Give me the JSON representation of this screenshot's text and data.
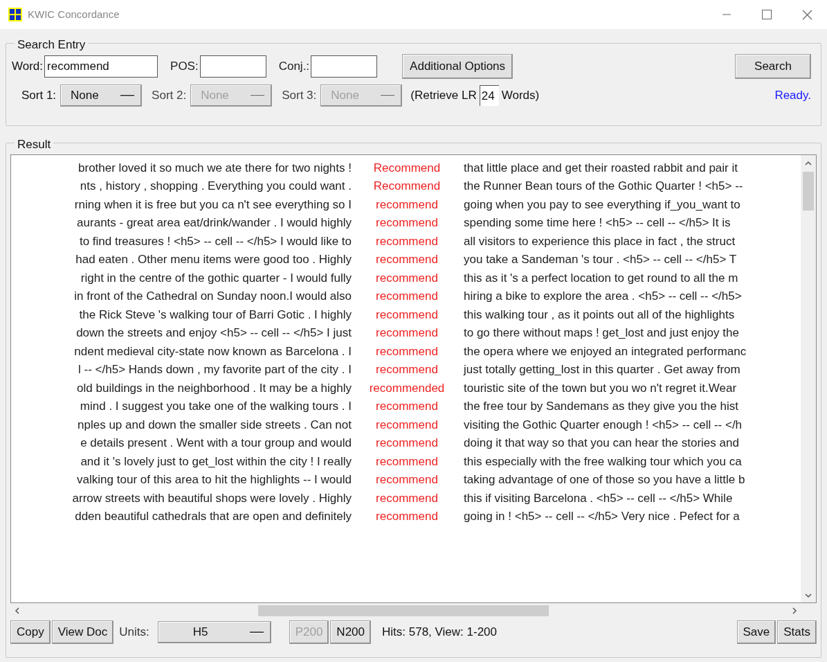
{
  "window": {
    "title": "KWIC Concordance"
  },
  "search_entry": {
    "title": "Search Entry",
    "word_label": "Word:",
    "word": "recommend",
    "pos_label": "POS:",
    "conj_label": "Conj.:",
    "options_button": "Additional Options",
    "search_button": "Search",
    "sorts": [
      {
        "label": "Sort 1:",
        "value": "None",
        "disabled": false
      },
      {
        "label": "Sort 2:",
        "value": "None",
        "disabled": true
      },
      {
        "label": "Sort 3:",
        "value": "None",
        "disabled": true
      }
    ],
    "retrieve_prefix": "(Retrieve LR",
    "retrieve_value": "24",
    "retrieve_suffix": "Words)",
    "status": "Ready."
  },
  "result": {
    "title": "Result",
    "rows": [
      {
        "left": "brother loved it so much we ate there for two nights !",
        "keyword": "Recommend",
        "right": "that little place and get their roasted rabbit and pair it"
      },
      {
        "left": "nts , history , shopping . Everything you could want .",
        "keyword": "Recommend",
        "right": "the Runner Bean tours of the Gothic Quarter ! <h5> --"
      },
      {
        "left": "rning when it is free but you ca n't see everything so I",
        "keyword": "recommend",
        "right": "going when you pay to see everything if_you_want to"
      },
      {
        "left": "aurants - great area eat/drink/wander . I would highly",
        "keyword": "recommend",
        "right": "spending some time here ! <h5> -- cell -- </h5> It is"
      },
      {
        "left": "to find treasures ! <h5> -- cell -- </h5> I would like to",
        "keyword": "recommend",
        "right": "all visitors to experience this place in fact , the struct"
      },
      {
        "left": "had eaten . Other menu items were good too . Highly",
        "keyword": "recommend",
        "right": "you take a Sandeman 's tour . <h5> -- cell -- </h5> T"
      },
      {
        "left": "right in the centre of the gothic quarter - I would fully",
        "keyword": "recommend",
        "right": "this as it 's a perfect location to get round to all the m"
      },
      {
        "left": "in front of the Cathedral on Sunday noon.I would also",
        "keyword": "recommend",
        "right": "hiring a bike to explore the area . <h5> -- cell -- </h5>"
      },
      {
        "left": "the Rick Steve 's walking tour of Barri Gotic . I highly",
        "keyword": "recommend",
        "right": "this walking tour , as it points out all of the highlights"
      },
      {
        "left": "down the streets and enjoy <h5> -- cell -- </h5> I just",
        "keyword": "recommend",
        "right": "to go there without maps ! get_lost and just enjoy the"
      },
      {
        "left": "ndent medieval city-state now known as Barcelona . I",
        "keyword": "recommend",
        "right": "the opera where we enjoyed an integrated performanc"
      },
      {
        "left": "l -- </h5> Hands down , my favorite part of the city . I",
        "keyword": "recommend",
        "right": "just totally getting_lost in this quarter . Get away from"
      },
      {
        "left": "old buildings in the neighborhood . It may be a highly",
        "keyword": "recommended",
        "right": "touristic site of the town but you wo n't regret it.Wear"
      },
      {
        "left": "mind . I suggest you take one of the walking tours . I",
        "keyword": "recommend",
        "right": "the free tour by Sandemans as they give you the hist"
      },
      {
        "left": "nples up and down the smaller side streets . Can not",
        "keyword": "recommend",
        "right": "visiting the Gothic Quarter enough ! <h5> -- cell -- </h"
      },
      {
        "left": "e details present . Went with a tour group and would",
        "keyword": "recommend",
        "right": "doing it that way so that you can hear the stories and"
      },
      {
        "left": "and it 's lovely just to get_lost within the city ! I really",
        "keyword": "recommend",
        "right": "this especially with the free walking tour which you ca"
      },
      {
        "left": "valking tour of this area to hit the highlights -- I would",
        "keyword": "recommend",
        "right": "taking advantage of one of those so you have a little b"
      },
      {
        "left": "arrow streets with beautiful shops were lovely . Highly",
        "keyword": "recommend",
        "right": "this if visiting Barcelona . <h5> -- cell -- </h5> While"
      },
      {
        "left": "dden beautiful cathedrals that are open and definitely",
        "keyword": "recommend",
        "right": "going in ! <h5> -- cell -- </h5> Very nice . Pefect for a"
      }
    ]
  },
  "bottom_bar": {
    "copy": "Copy",
    "view_doc": "View Doc",
    "units_label": "Units:",
    "units_value": "H5",
    "pager": [
      {
        "label": "P200",
        "disabled": true
      },
      {
        "label": "N200",
        "disabled": false
      }
    ],
    "hits": "Hits: 578, View: 1-200",
    "save": "Save",
    "stats": "Stats"
  }
}
